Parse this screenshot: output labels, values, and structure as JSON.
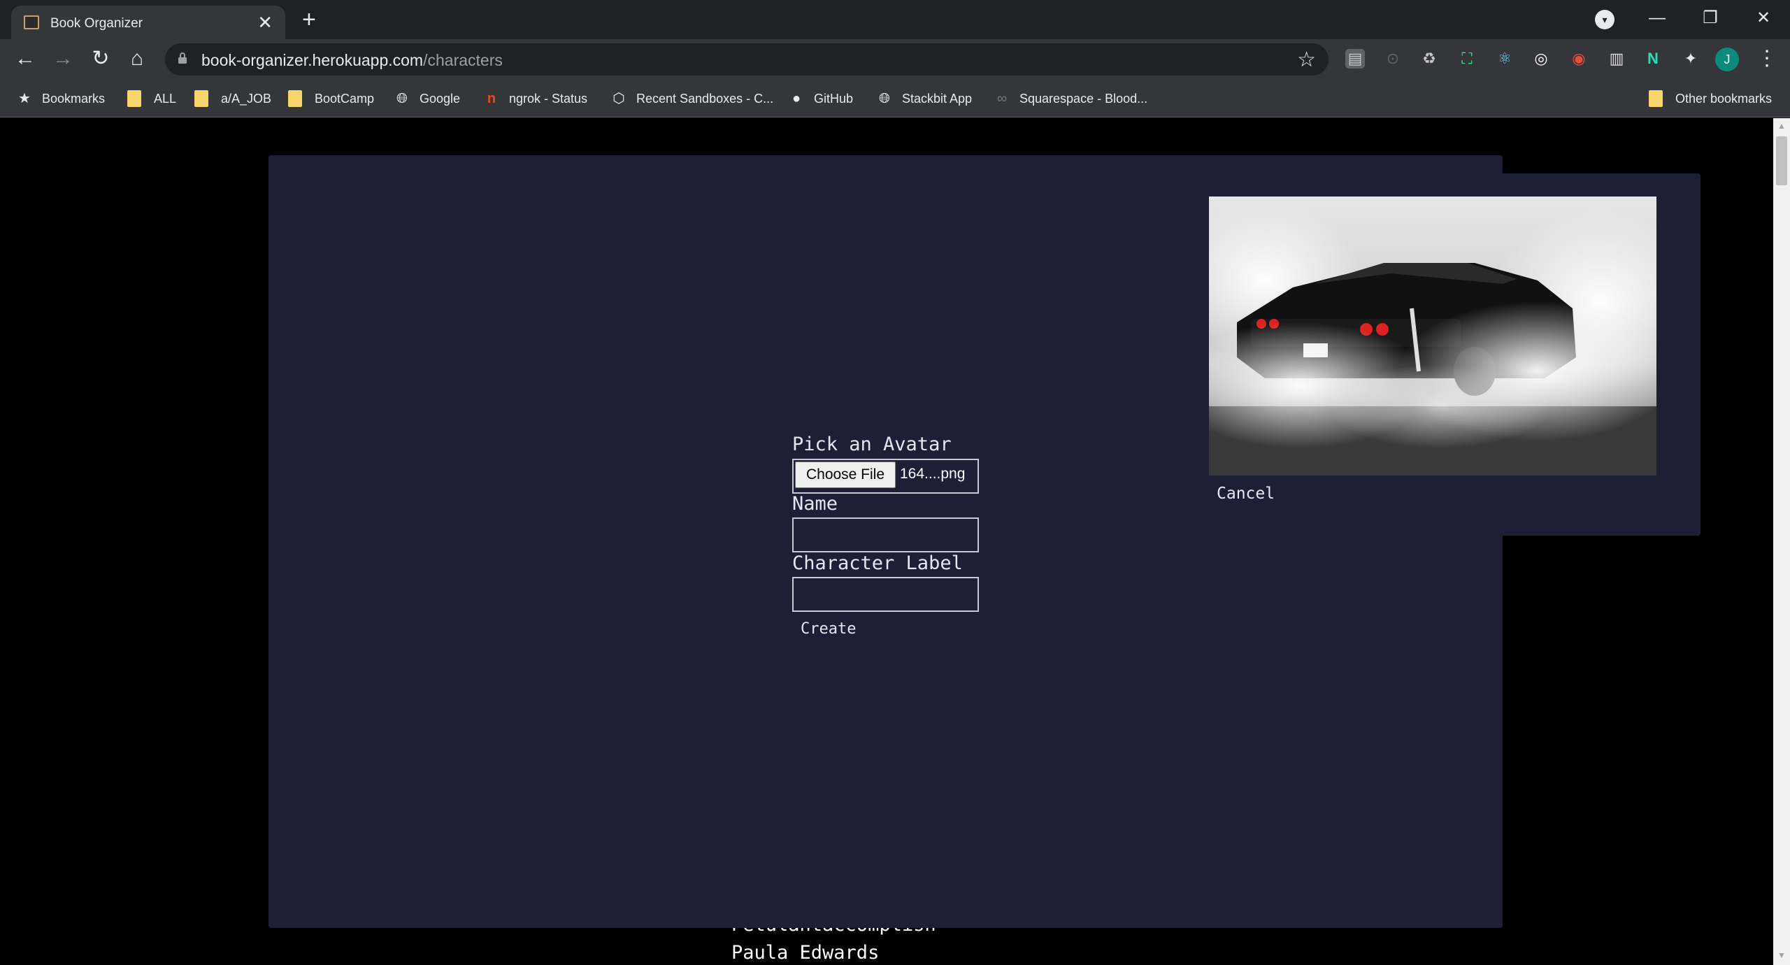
{
  "browser": {
    "tab_title": "Book Organizer",
    "tab_close": "✕",
    "new_tab": "+",
    "url_host": "book-organizer.herokuapp.com",
    "url_path": "/characters",
    "profile_initial": "J",
    "window_controls": {
      "minimize": "—",
      "restore": "❐",
      "close": "✕"
    }
  },
  "bookmarks": {
    "items": [
      {
        "label": "Bookmarks",
        "icon": "star-icon"
      },
      {
        "label": "ALL",
        "icon": "folder-icon"
      },
      {
        "label": "a/A_JOB",
        "icon": "folder-icon"
      },
      {
        "label": "BootCamp",
        "icon": "folder-icon"
      },
      {
        "label": "Google",
        "icon": "globe-icon"
      },
      {
        "label": "ngrok - Status",
        "icon": "ngrok-icon"
      },
      {
        "label": "Recent Sandboxes - C...",
        "icon": "codesandbox-icon"
      },
      {
        "label": "GitHub",
        "icon": "github-icon"
      },
      {
        "label": "Stackbit App",
        "icon": "globe-icon"
      },
      {
        "label": "Squarespace - Blood...",
        "icon": "squarespace-icon"
      }
    ],
    "other": "Other bookmarks"
  },
  "form": {
    "avatar_label": "Pick an Avatar",
    "choose_file": "Choose File",
    "file_name": "164....png",
    "name_label": "Name",
    "name_value": "",
    "character_label": "Character Label",
    "character_value": "",
    "create": "Create"
  },
  "preview": {
    "cancel": "Cancel"
  },
  "background_list": [
    "Petulantaccomplish",
    "Paula Edwards"
  ]
}
